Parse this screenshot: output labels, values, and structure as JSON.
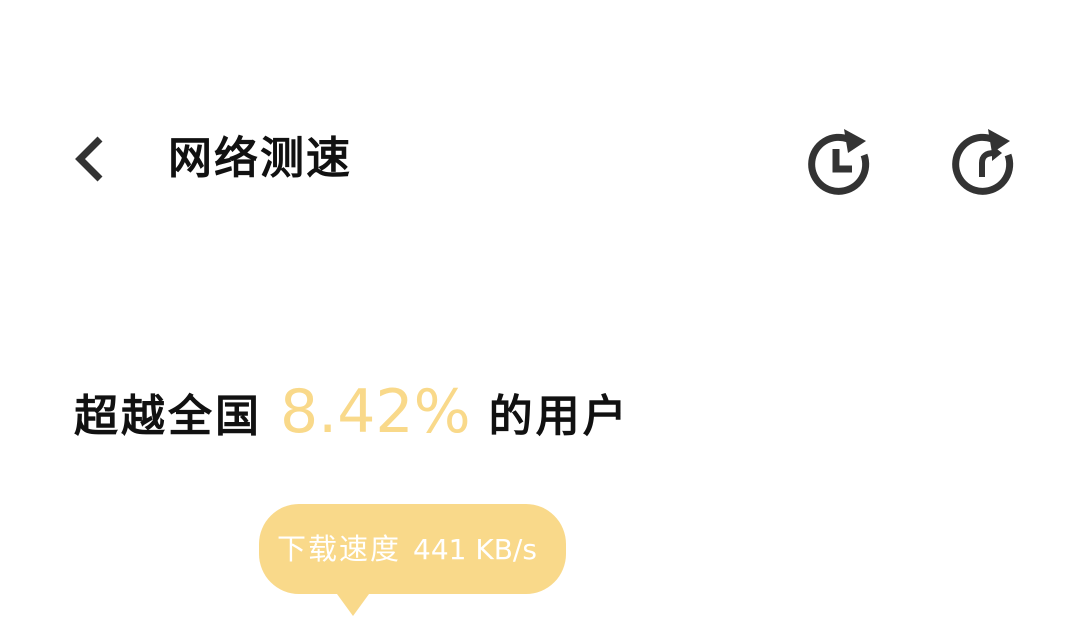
{
  "header": {
    "title": "网络测速",
    "back_icon": "chevron-left-icon",
    "history_icon": "history-clock-icon",
    "retest_icon": "refresh-icon"
  },
  "summary": {
    "prefix": "超越全国",
    "percent": "8.42%",
    "suffix": "的用户"
  },
  "speed": {
    "label": "下载速度",
    "value": "441 KB/s"
  },
  "colors": {
    "accent": "#f9d98a",
    "text": "#111111",
    "icon": "#333333",
    "background": "#ffffff"
  }
}
